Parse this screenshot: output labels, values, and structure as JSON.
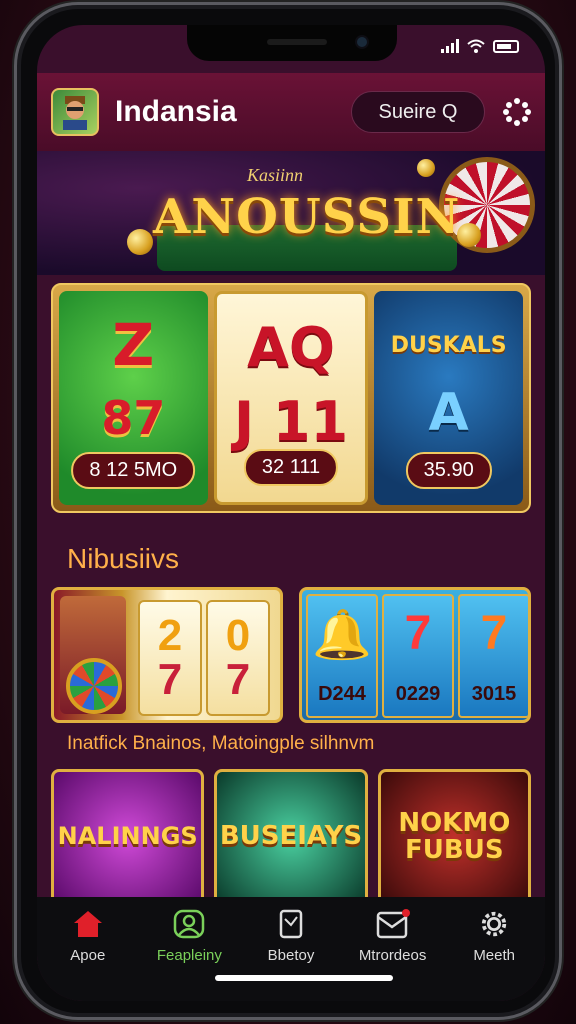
{
  "app": {
    "title": "Indansia",
    "search_label": "Sueire Q"
  },
  "banner": {
    "subtitle": "Kasiinn",
    "title": "ANOUSSIN"
  },
  "featured_slot": {
    "reels": [
      {
        "symbols": [
          "Z",
          "87"
        ],
        "value": "8 12 5MO"
      },
      {
        "symbols": [
          "AQ",
          "J 11"
        ],
        "value": "32 111"
      },
      {
        "symbols": [
          "DUSKALS",
          "A"
        ],
        "value": "35.90"
      }
    ]
  },
  "section": {
    "title": "Nibusiivs",
    "caption": "Inatfick Bnainos, Matoingple silhnvm"
  },
  "mini_slot": {
    "digits": [
      [
        "2",
        "7"
      ],
      [
        "0",
        "7"
      ]
    ]
  },
  "jackpots": [
    {
      "value": "D244",
      "icon": "bell-icon"
    },
    {
      "value": "0229",
      "icon": "seven-icon"
    },
    {
      "value": "3015",
      "icon": "seven-icon"
    }
  ],
  "games": [
    {
      "title": "NALINNGS"
    },
    {
      "title": "BUSEIAYS"
    },
    {
      "title": "NOKMO FUBUS"
    }
  ],
  "tabs": [
    {
      "label": "Apoe",
      "icon": "home-icon",
      "color": "#e0202a"
    },
    {
      "label": "Feapleiny",
      "icon": "user-icon",
      "color": "#7ad05a"
    },
    {
      "label": "Bbetoy",
      "icon": "tablet-icon",
      "color": "#dddddd"
    },
    {
      "label": "Mtrordeos",
      "icon": "mail-icon",
      "color": "#dddddd"
    },
    {
      "label": "Meeth",
      "icon": "gear-icon",
      "color": "#dddddd"
    }
  ]
}
